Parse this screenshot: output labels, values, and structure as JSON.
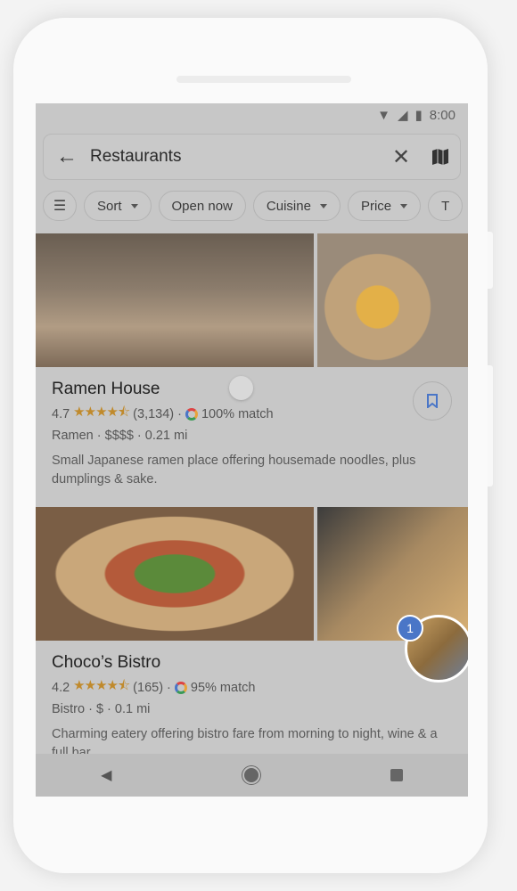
{
  "status_bar": {
    "time": "8:00"
  },
  "search": {
    "query": "Restaurants"
  },
  "filters": [
    {
      "label": "Sort",
      "dropdown": true
    },
    {
      "label": "Open now",
      "dropdown": false
    },
    {
      "label": "Cuisine",
      "dropdown": true
    },
    {
      "label": "Price",
      "dropdown": true
    },
    {
      "label": "T",
      "dropdown": false
    }
  ],
  "results": [
    {
      "name": "Ramen House",
      "rating": "4.7",
      "stars": "★★★★⯪",
      "reviews": "(3,134)",
      "match": "100% match",
      "details": "Ramen · $$$$ · 0.21 mi",
      "description": "Small Japanese ramen place offering housemade noodles, plus dumplings & sake."
    },
    {
      "name": "Choco’s Bistro",
      "rating": "4.2",
      "stars": "★★★★⯪",
      "reviews": "(165)",
      "match": "95% match",
      "details": "Bistro · $ · 0.1 mi",
      "description": "Charming eatery offering bistro fare from morning to night, wine & a full bar."
    }
  ],
  "floating_thumb": {
    "badge_count": "1"
  },
  "colors": {
    "accent": "#4a76c7",
    "star": "#c08a2c"
  }
}
